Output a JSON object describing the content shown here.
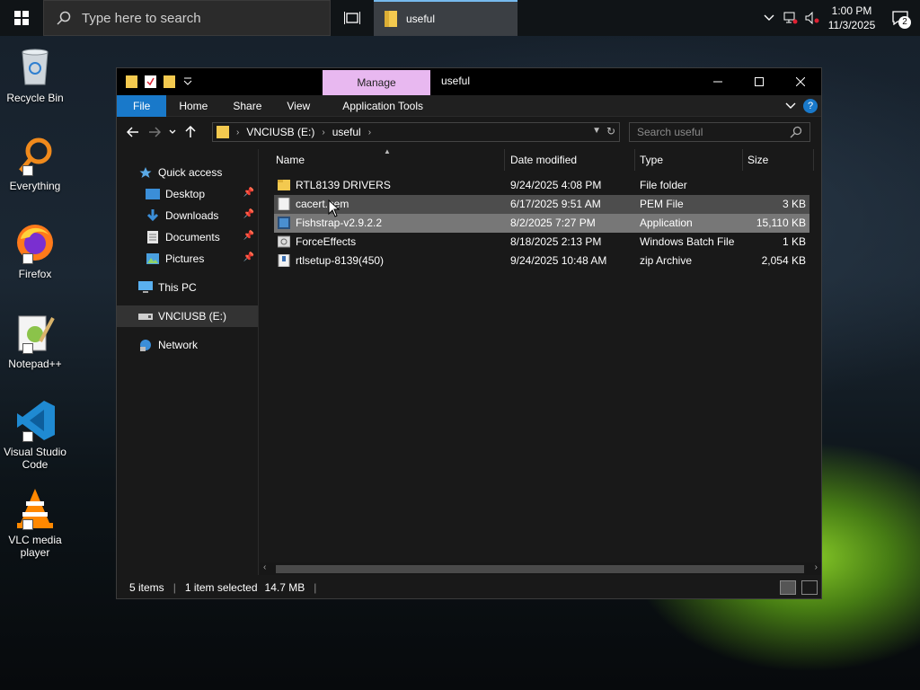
{
  "taskbar": {
    "search_placeholder": "Type here to search",
    "active_app_label": "useful",
    "clock_time": "1:00 PM",
    "clock_date": "11/3/2025",
    "notification_count": "2"
  },
  "desktop": {
    "icons": [
      {
        "label": "Recycle Bin",
        "icon": "recycle-bin-icon"
      },
      {
        "label": "Everything",
        "icon": "everything-search-icon"
      },
      {
        "label": "Firefox",
        "icon": "firefox-icon"
      },
      {
        "label": "Notepad++",
        "icon": "notepad-plus-plus-icon"
      },
      {
        "label": "Visual Studio Code",
        "icon": "vscode-icon"
      },
      {
        "label": "VLC media player",
        "icon": "vlc-icon"
      }
    ]
  },
  "window": {
    "title": "useful",
    "manage_tab": "Manage",
    "ribbon_tabs": {
      "file": "File",
      "home": "Home",
      "share": "Share",
      "view": "View",
      "app_tools": "Application Tools"
    },
    "address": {
      "drive": "VNCIUSB (E:)",
      "folder": "useful"
    },
    "search_placeholder": "Search useful",
    "nav": {
      "quick_access": "Quick access",
      "desktop": "Desktop",
      "downloads": "Downloads",
      "documents": "Documents",
      "pictures": "Pictures",
      "this_pc": "This PC",
      "usb": "VNCIUSB (E:)",
      "network": "Network"
    },
    "columns": {
      "name": "Name",
      "date": "Date modified",
      "type": "Type",
      "size": "Size"
    },
    "files": [
      {
        "name": "RTL8139 DRIVERS",
        "date": "9/24/2025 4:08 PM",
        "type": "File folder",
        "size": ""
      },
      {
        "name": "cacert.pem",
        "date": "6/17/2025 9:51 AM",
        "type": "PEM File",
        "size": "3 KB"
      },
      {
        "name": "Fishstrap-v2.9.2.2",
        "date": "8/2/2025 7:27 PM",
        "type": "Application",
        "size": "15,110 KB"
      },
      {
        "name": "ForceEffects",
        "date": "8/18/2025 2:13 PM",
        "type": "Windows Batch File",
        "size": "1 KB"
      },
      {
        "name": "rtlsetup-8139(450)",
        "date": "9/24/2025 10:48 AM",
        "type": "zip Archive",
        "size": "2,054 KB"
      }
    ],
    "status": {
      "items": "5 items",
      "selected": "1 item selected",
      "size": "14.7 MB"
    }
  },
  "colors": {
    "accent": "#1979ca",
    "manage_tab": "#e8b8f0",
    "folder": "#f3c94f"
  }
}
